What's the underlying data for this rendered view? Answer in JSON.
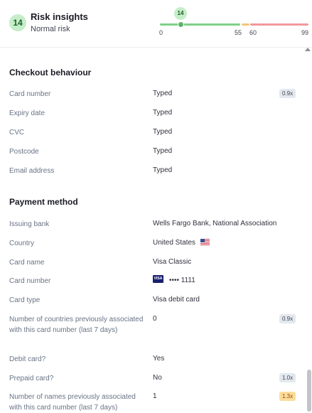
{
  "risk": {
    "score": "14",
    "title": "Risk insights",
    "subtitle": "Normal risk",
    "marker": "14",
    "ticks": [
      "0",
      "55",
      "60",
      "99"
    ]
  },
  "checkout": {
    "title": "Checkout behaviour",
    "rows": [
      {
        "label": "Card number",
        "value": "Typed",
        "chip": "0.9x"
      },
      {
        "label": "Expiry date",
        "value": "Typed"
      },
      {
        "label": "CVC",
        "value": "Typed"
      },
      {
        "label": "Postcode",
        "value": "Typed"
      },
      {
        "label": "Email address",
        "value": "Typed"
      }
    ]
  },
  "payment": {
    "title": "Payment method",
    "rows": [
      {
        "label": "Issuing bank",
        "value": "Wells Fargo Bank, National Association"
      },
      {
        "label": "Country",
        "value": "United States",
        "icon": "us-flag-icon"
      },
      {
        "label": "Card name",
        "value": "Visa Classic"
      },
      {
        "label": "Card number",
        "value": "•••• 1111",
        "icon": "visa-icon",
        "icon_text": "VISA"
      },
      {
        "label": "Card type",
        "value": "Visa debit card"
      },
      {
        "label": "Number of countries previously associated with this card number (last 7 days)",
        "value": "0",
        "chip": "0.9x"
      },
      {
        "label": "Debit card?",
        "value": "Yes"
      },
      {
        "label": "Prepaid card?",
        "value": "No",
        "chip": "1.0x"
      },
      {
        "label": "Number of names previously associated with this card number (last 7 days)",
        "value": "1",
        "chip": "1.3x",
        "chip_color": "#fcdc9b"
      }
    ]
  },
  "colors": {
    "low_risk": "#7fcf89",
    "elevated_risk": "#f3c678",
    "high_risk": "#f1999c",
    "chip_default": "#e3e8ee"
  }
}
